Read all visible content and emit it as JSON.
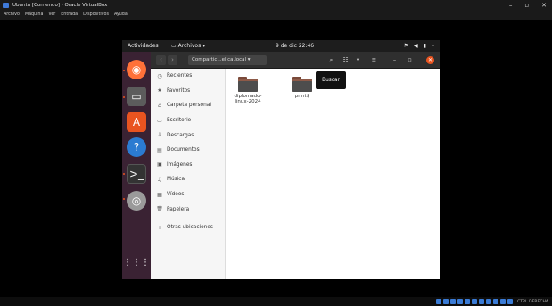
{
  "vbox": {
    "window_title": "Ubuntu [Corriendo] - Oracle VirtualBox",
    "menu": [
      "Archivo",
      "Máquina",
      "Ver",
      "Entrada",
      "Dispositivos",
      "Ayuda"
    ],
    "status_right": "CTRL DERECHA"
  },
  "ubuntu": {
    "topbar": {
      "activities": "Actividades",
      "app_menu": "Archivos",
      "clock": "9 de dic  22:46"
    },
    "dock": {
      "items": [
        "firefox-icon",
        "files-icon",
        "software-center-icon",
        "help-icon",
        "terminal-icon",
        "optical-disc-icon",
        "show-apps-icon"
      ]
    },
    "files": {
      "path_label": "Compartic...elica.local",
      "sidebar": [
        {
          "icon": "clock-icon",
          "label": "Recientes"
        },
        {
          "icon": "star-icon",
          "label": "Favoritos"
        },
        {
          "icon": "home-icon",
          "label": "Carpeta personal"
        },
        {
          "icon": "desktop-icon",
          "label": "Escritorio"
        },
        {
          "icon": "download-icon",
          "label": "Descargas"
        },
        {
          "icon": "document-icon",
          "label": "Documentos"
        },
        {
          "icon": "image-icon",
          "label": "Imágenes"
        },
        {
          "icon": "music-icon",
          "label": "Música"
        },
        {
          "icon": "video-icon",
          "label": "Vídeos"
        },
        {
          "icon": "trash-icon",
          "label": "Papelera"
        },
        {
          "icon": "plus-icon",
          "label": "Otras ubicaciones"
        }
      ],
      "items": [
        {
          "name": "diplomado-\nlinux-2024"
        },
        {
          "name": "print$"
        }
      ],
      "tooltip": "Buscar"
    }
  }
}
